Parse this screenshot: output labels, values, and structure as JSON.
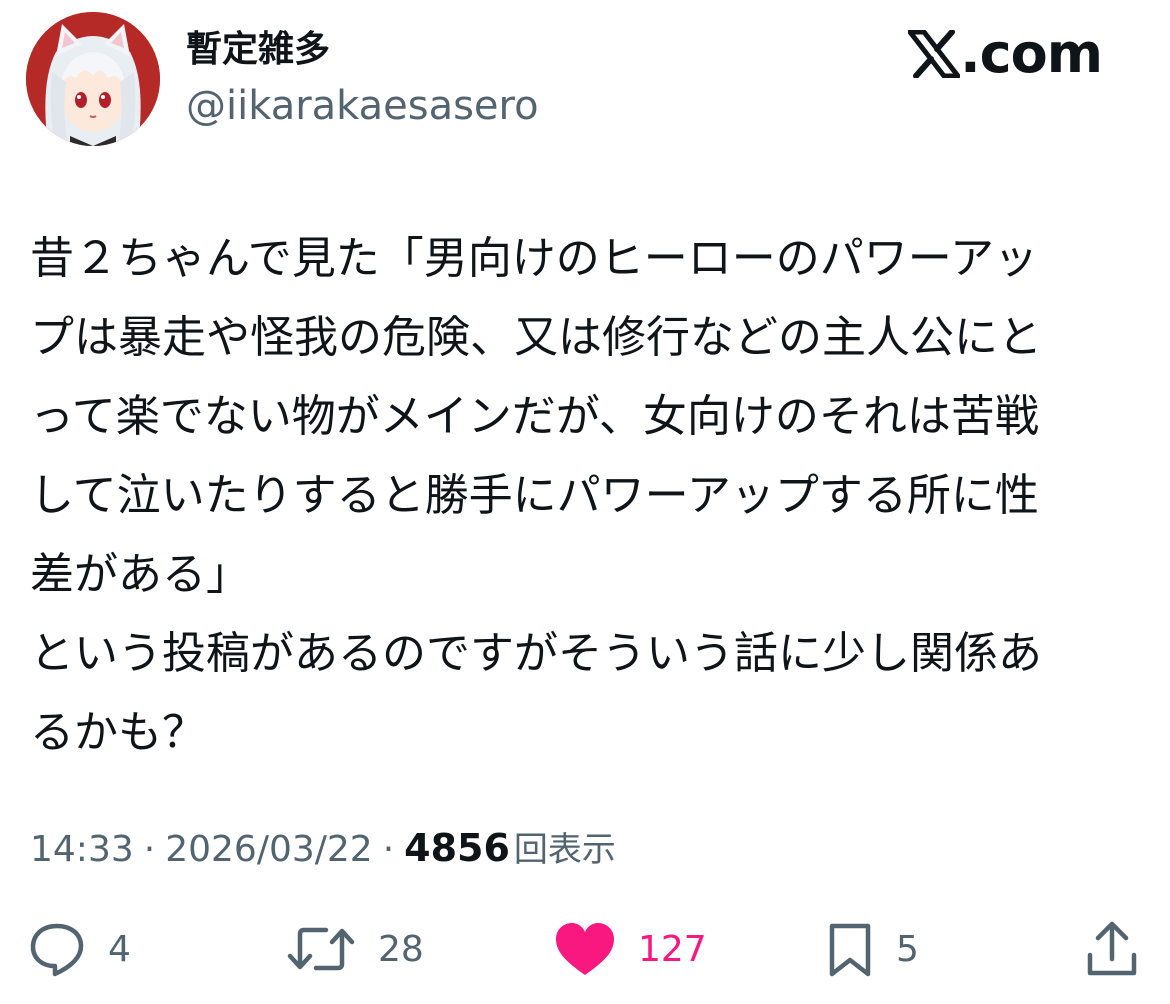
{
  "author": {
    "display_name": "暫定雑多",
    "handle": "@iikarakaesasero",
    "avatar_icon": "avatar-anime-girl"
  },
  "brand": {
    "text": ".com",
    "icon": "x-logo-icon"
  },
  "tweet": {
    "lines": [
      "昔２ちゃんで見た「男向けのヒーローのパワーアッ",
      "プは暴走や怪我の危険、又は修行などの主人公にと",
      "って楽でない物がメインだが、女向けのそれは苦戦",
      "して泣いたりすると勝手にパワーアップする所に性",
      "差がある」",
      "という投稿があるのですがそういう話に少し関係あ",
      "るかも？"
    ]
  },
  "meta": {
    "time": "14:33",
    "separator": "·",
    "date": "2026/03/22",
    "views": "4856",
    "views_label": "回表示"
  },
  "actions": {
    "reply_count": "4",
    "retweet_count": "28",
    "like_count": "127",
    "bookmark_count": "5",
    "like_color": "#f91880",
    "muted_color": "#536471"
  }
}
